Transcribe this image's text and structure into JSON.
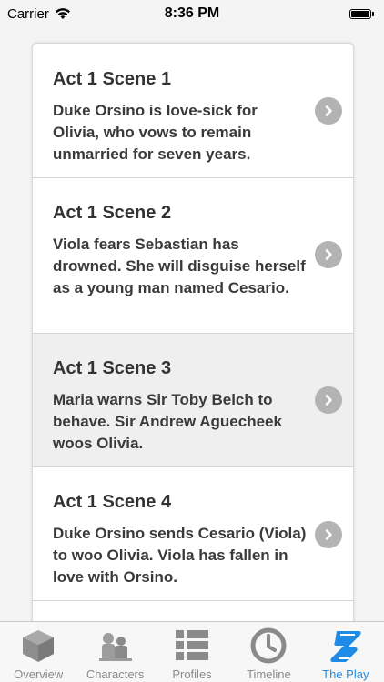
{
  "status": {
    "carrier": "Carrier",
    "time": "8:36 PM"
  },
  "scenes": [
    {
      "title": "Act 1 Scene 1",
      "description": "Duke Orsino is love-sick for Olivia, who vows to remain unmarried for seven years."
    },
    {
      "title": "Act 1 Scene 2",
      "description": "Viola fears Sebastian has drowned. She will disguise herself as a young man named Cesario."
    },
    {
      "title": "Act 1 Scene 3",
      "description": "Maria warns Sir Toby Belch to behave. Sir Andrew Aguecheek woos Olivia."
    },
    {
      "title": "Act 1 Scene 4",
      "description": "Duke Orsino sends Cesario (Viola) to woo Olivia. Viola has fallen in love with Orsino."
    }
  ],
  "tabs": [
    {
      "label": "Overview",
      "icon": "cube-icon"
    },
    {
      "label": "Characters",
      "icon": "characters-icon"
    },
    {
      "label": "Profiles",
      "icon": "list-icon"
    },
    {
      "label": "Timeline",
      "icon": "clock-icon"
    },
    {
      "label": "The Play",
      "icon": "scroll-icon"
    }
  ],
  "colors": {
    "accent": "#1e8ce6",
    "inactive": "#8a8a8a"
  }
}
